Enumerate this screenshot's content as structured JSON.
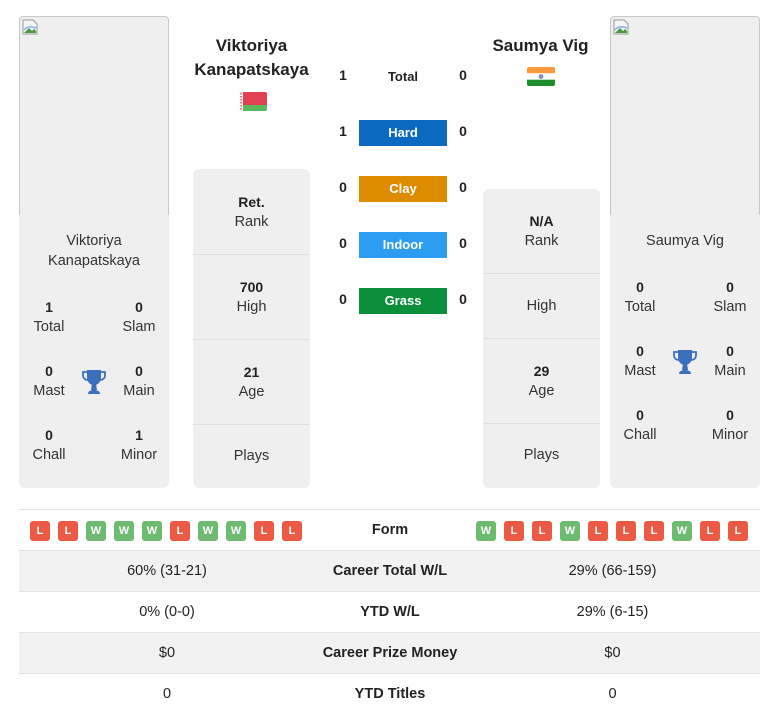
{
  "players": {
    "left": {
      "name": "Viktoriya Kanapatskaya",
      "name_line1": "Viktoriya",
      "name_line2": "Kanapatskaya",
      "country": "Belarus",
      "flag_icon": "belarus-flag-icon",
      "titles": {
        "total": "1",
        "total_label": "Total",
        "slam": "0",
        "slam_label": "Slam",
        "mast": "0",
        "mast_label": "Mast",
        "main": "0",
        "main_label": "Main",
        "chall": "0",
        "chall_label": "Chall",
        "minor": "1",
        "minor_label": "Minor"
      },
      "stats": {
        "rank": "Ret.",
        "rank_label": "Rank",
        "high": "700",
        "high_label": "High",
        "age": "21",
        "age_label": "Age",
        "plays": "",
        "plays_label": "Plays"
      }
    },
    "right": {
      "name": "Saumya Vig",
      "country": "India",
      "flag_icon": "india-flag-icon",
      "titles": {
        "total": "0",
        "total_label": "Total",
        "slam": "0",
        "slam_label": "Slam",
        "mast": "0",
        "mast_label": "Mast",
        "main": "0",
        "main_label": "Main",
        "chall": "0",
        "chall_label": "Chall",
        "minor": "0",
        "minor_label": "Minor"
      },
      "stats": {
        "rank": "N/A",
        "rank_label": "Rank",
        "high": "",
        "high_label": "High",
        "age": "29",
        "age_label": "Age",
        "plays": "",
        "plays_label": "Plays"
      }
    }
  },
  "h2h": [
    {
      "label": "Total",
      "left": "1",
      "right": "0",
      "color": ""
    },
    {
      "label": "Hard",
      "left": "1",
      "right": "0",
      "color": "#0b6abf"
    },
    {
      "label": "Clay",
      "left": "0",
      "right": "0",
      "color": "#dd8c00"
    },
    {
      "label": "Indoor",
      "left": "0",
      "right": "0",
      "color": "#2d9df2"
    },
    {
      "label": "Grass",
      "left": "0",
      "right": "0",
      "color": "#0b8f3a"
    }
  ],
  "form": {
    "label": "Form",
    "left": [
      "L",
      "L",
      "W",
      "W",
      "W",
      "L",
      "W",
      "W",
      "L",
      "L"
    ],
    "right": [
      "W",
      "L",
      "L",
      "W",
      "L",
      "L",
      "L",
      "W",
      "L",
      "L"
    ],
    "colors": {
      "W": "#6dbb6f",
      "L": "#ec5a45"
    }
  },
  "comparison": [
    {
      "label": "Career Total W/L",
      "left": "60% (31-21)",
      "right": "29% (66-159)"
    },
    {
      "label": "YTD W/L",
      "left": "0% (0-0)",
      "right": "29% (6-15)"
    },
    {
      "label": "Career Prize Money",
      "left": "$0",
      "right": "$0"
    },
    {
      "label": "YTD Titles",
      "left": "0",
      "right": "0"
    }
  ],
  "colors": {
    "card_bg": "#efefef",
    "trophy": "#3a6fc0"
  }
}
